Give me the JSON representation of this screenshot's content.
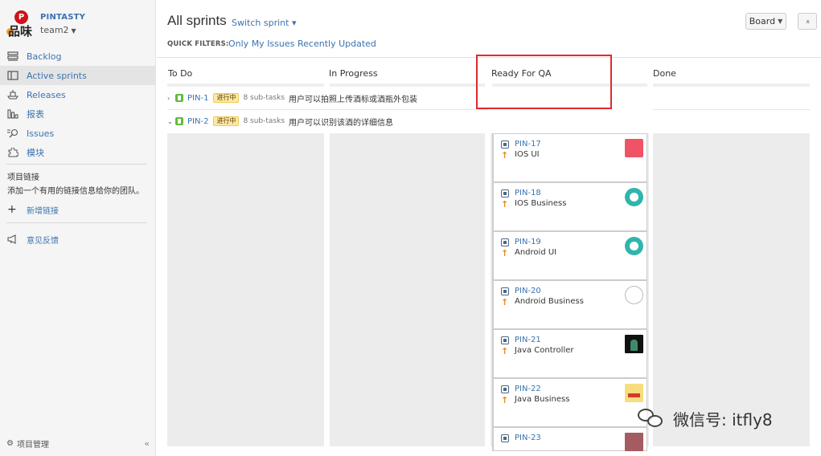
{
  "project": {
    "logo_letter": "P",
    "logo_text": "品味",
    "name": "PINTASTY",
    "team": "team2"
  },
  "nav": {
    "backlog": "Backlog",
    "active_sprints": "Active sprints",
    "releases": "Releases",
    "reports": "报表",
    "issues": "Issues",
    "modules": "模块"
  },
  "links": {
    "title": "项目链接",
    "description": "添加一个有用的链接信息给你的团队。",
    "add": "新增链接",
    "plus": "+"
  },
  "feedback": "意见反馈",
  "footer": {
    "project_admin": "项目管理",
    "collapse": "«"
  },
  "header": {
    "title": "All sprints",
    "switch_sprint": "Switch sprint",
    "caret": "▾",
    "board_button": "Board",
    "expand_button": "«"
  },
  "quick_filters": {
    "label": "QUICK FILTERS:",
    "only_my_issues": "Only My Issues",
    "recently_updated": "Recently Updated"
  },
  "columns": {
    "todo": "To Do",
    "in_progress": "In Progress",
    "ready_for_qa": "Ready For QA",
    "done": "Done"
  },
  "swimlanes": [
    {
      "toggle": "›",
      "key": "PIN-1",
      "status": "进行中",
      "subtasks": "8 sub-tasks",
      "summary": "用户可以拍照上传酒标或酒瓶外包装"
    },
    {
      "toggle": "⌄",
      "key": "PIN-2",
      "status": "进行中",
      "subtasks": "8 sub-tasks",
      "summary": "用户可以识别该酒的详细信息"
    }
  ],
  "cards": [
    {
      "key": "PIN-17",
      "summary": "IOS UI",
      "priority": "↑",
      "avatar": "pink-avatar"
    },
    {
      "key": "PIN-18",
      "summary": "IOS Business",
      "priority": "↑",
      "avatar": "teal-avatar"
    },
    {
      "key": "PIN-19",
      "summary": "Android UI",
      "priority": "↑",
      "avatar": "teal-avatar"
    },
    {
      "key": "PIN-20",
      "summary": "Android Business",
      "priority": "↑",
      "avatar": "ghost-avatar"
    },
    {
      "key": "PIN-21",
      "summary": "Java Controller",
      "priority": "↑",
      "avatar": "dark-avatar"
    },
    {
      "key": "PIN-22",
      "summary": "Java Business",
      "priority": "↑",
      "avatar": "cartoon-avatar"
    },
    {
      "key": "PIN-23",
      "summary": "",
      "priority": "",
      "avatar": "mauve-avatar"
    }
  ],
  "watermark": "微信号: itfly8",
  "colors": {
    "link": "#3b73af",
    "highlight": "#e02a2a",
    "story": "#63ba3c",
    "priority": "#e68a1f"
  }
}
